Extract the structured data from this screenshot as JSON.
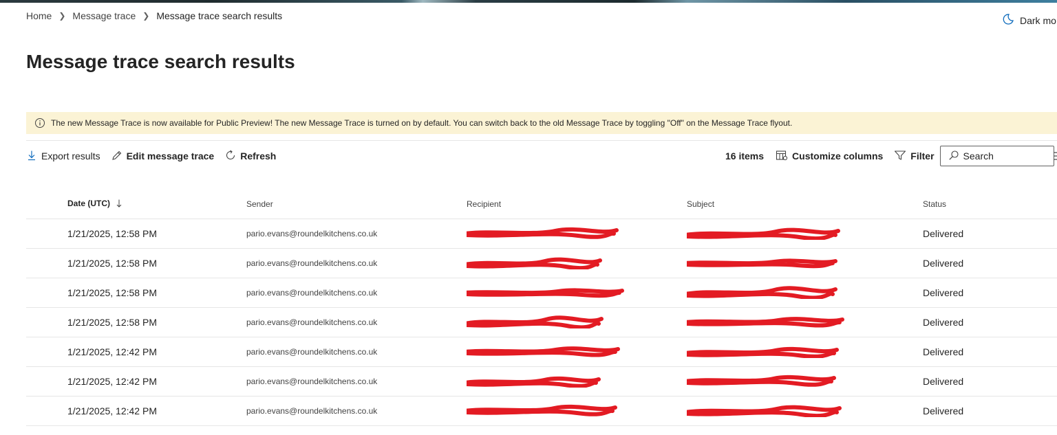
{
  "breadcrumb": {
    "items": [
      "Home",
      "Message trace",
      "Message trace search results"
    ]
  },
  "header": {
    "dark_mode_label": "Dark mo"
  },
  "page": {
    "title": "Message trace search results"
  },
  "banner": {
    "text": "The new Message Trace is now available for Public Preview! The new Message Trace is turned on by default. You can switch back to the old Message Trace by toggling \"Off\" on the Message Trace flyout."
  },
  "toolbar": {
    "export_label": "Export results",
    "edit_label": "Edit message trace",
    "refresh_label": "Refresh",
    "items_count": "16 items",
    "customize_label": "Customize columns",
    "filter_label": "Filter",
    "search_placeholder": "Search"
  },
  "table": {
    "columns": [
      "Date (UTC)",
      "Sender",
      "Recipient",
      "Subject",
      "Status"
    ],
    "sort_column": "Date (UTC)",
    "sort_direction": "descending",
    "rows": [
      {
        "date": "1/21/2025, 12:58 PM",
        "sender": "pario.evans@roundelkitchens.co.uk",
        "status": "Delivered"
      },
      {
        "date": "1/21/2025, 12:58 PM",
        "sender": "pario.evans@roundelkitchens.co.uk",
        "status": "Delivered"
      },
      {
        "date": "1/21/2025, 12:58 PM",
        "sender": "pario.evans@roundelkitchens.co.uk",
        "status": "Delivered"
      },
      {
        "date": "1/21/2025, 12:58 PM",
        "sender": "pario.evans@roundelkitchens.co.uk",
        "status": "Delivered"
      },
      {
        "date": "1/21/2025, 12:42 PM",
        "sender": "pario.evans@roundelkitchens.co.uk",
        "status": "Delivered"
      },
      {
        "date": "1/21/2025, 12:42 PM",
        "sender": "pario.evans@roundelkitchens.co.uk",
        "status": "Delivered"
      },
      {
        "date": "1/21/2025, 12:42 PM",
        "sender": "pario.evans@roundelkitchens.co.uk",
        "status": "Delivered"
      }
    ]
  },
  "colors": {
    "banner_bg": "#fbf3d5",
    "redaction": "#e31b23",
    "text": "#242424"
  },
  "icons": [
    "chevron-right-icon",
    "moon-icon",
    "info-icon",
    "download-icon",
    "pencil-icon",
    "refresh-icon",
    "columns-icon",
    "filter-icon",
    "search-icon",
    "sort-down-icon",
    "more-lines-icon"
  ]
}
